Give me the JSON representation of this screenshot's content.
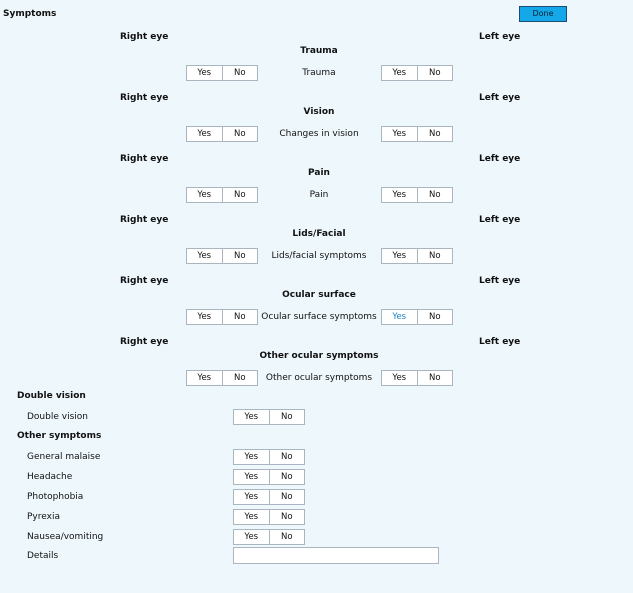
{
  "page": {
    "title": "Symptoms",
    "done_label": "Done"
  },
  "eye": {
    "right_label": "Right eye",
    "left_label": "Left eye"
  },
  "yes_no": {
    "yes": "Yes",
    "no": "No"
  },
  "ocular_sections": [
    {
      "heading": "Trauma",
      "row_label": "Trauma",
      "right_selected": "",
      "left_selected": ""
    },
    {
      "heading": "Vision",
      "row_label": "Changes in vision",
      "right_selected": "",
      "left_selected": ""
    },
    {
      "heading": "Pain",
      "row_label": "Pain",
      "right_selected": "",
      "left_selected": ""
    },
    {
      "heading": "Lids/Facial",
      "row_label": "Lids/facial symptoms",
      "right_selected": "",
      "left_selected": ""
    },
    {
      "heading": "Ocular surface",
      "row_label": "Ocular surface symptoms",
      "right_selected": "",
      "left_selected": "Yes"
    },
    {
      "heading": "Other ocular symptoms",
      "row_label": "Other ocular symptoms",
      "right_selected": "",
      "left_selected": ""
    }
  ],
  "double_vision": {
    "heading": "Double vision",
    "items": [
      {
        "label": "Double vision"
      }
    ]
  },
  "other_symptoms": {
    "heading": "Other symptoms",
    "items": [
      {
        "label": "General malaise"
      },
      {
        "label": "Headache"
      },
      {
        "label": "Photophobia"
      },
      {
        "label": "Pyrexia"
      },
      {
        "label": "Nausea/vomiting"
      }
    ],
    "details_label": "Details",
    "details_value": ""
  }
}
